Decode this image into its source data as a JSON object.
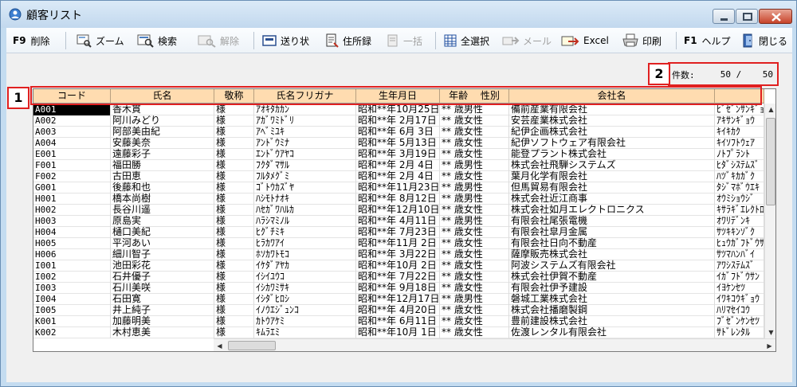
{
  "window": {
    "title": "顧客リスト"
  },
  "toolbar": {
    "delete": {
      "key": "F9",
      "label": "削除"
    },
    "zoom": "ズーム",
    "search": "検索",
    "release": "解除",
    "invoice": "送り状",
    "address_book": "住所録",
    "bulk": "一括",
    "select_all": "全選択",
    "mail": "メール",
    "excel": "Excel",
    "print": "印刷",
    "help": {
      "key": "F1",
      "label": "ヘルプ"
    },
    "close": "閉じる"
  },
  "count": {
    "label": "件数:",
    "value": "50 /    50"
  },
  "markers": {
    "m1": "1",
    "m2": "2"
  },
  "grid": {
    "columns": [
      "コード",
      "氏名",
      "敬称",
      "氏名フリガナ",
      "生年月日",
      "年齢　 性別",
      "会社名",
      ""
    ],
    "rows": [
      [
        "A001",
        "香木貫",
        "様",
        "ｱｵｷﾀｶｶﾝ",
        "昭和**年10月25日",
        "** 歳男性",
        "備前産業有限会社",
        "ﾋﾞｾﾞﾝｻﾝｷﾞｮ"
      ],
      [
        "A002",
        "阿川みどり",
        "様",
        "ｱｶﾞﾜﾐﾄﾞﾘ",
        "昭和**年 2月17日",
        "** 歳女性",
        "安芸産業株式会社",
        "ｱｷｻﾝｷﾞｮｳ"
      ],
      [
        "A003",
        "阿部美由紀",
        "様",
        "ｱﾍﾞﾐﾕｷ",
        "昭和**年 6月 3日",
        "** 歳女性",
        "紀伊企画株式会社",
        "ｷｲｷｶｸ"
      ],
      [
        "A004",
        "安藤美奈",
        "様",
        "ｱﾝﾄﾞｳﾐﾅ",
        "昭和**年 5月13日",
        "** 歳女性",
        "紀伊ソフトウェア有限会社",
        "ｷｲｿﾌﾄｳｪｱ"
      ],
      [
        "E001",
        "遠藤彩子",
        "様",
        "ｴﾝﾄﾞｳｱﾔｺ",
        "昭和**年 3月19日",
        "** 歳女性",
        "能登プラント株式会社",
        "ﾉﾄﾌﾟﾗﾝﾄ"
      ],
      [
        "F001",
        "福田勝",
        "様",
        "ﾌｸﾀﾞﾏｻﾙ",
        "昭和**年 2月 4日",
        "** 歳男性",
        "株式会社飛騨システムズ",
        "ﾋﾀﾞｼｽﾃﾑｽﾞ"
      ],
      [
        "F002",
        "古田恵",
        "様",
        "ﾌﾙﾀﾒｸﾞﾐ",
        "昭和**年 2月 4日",
        "** 歳女性",
        "葉月化学有限会社",
        "ﾊﾂﾞｷｶｶﾞｸ"
      ],
      [
        "G001",
        "後藤和也",
        "様",
        "ｺﾞﾄｳｶｽﾞﾔ",
        "昭和**年11月23日",
        "** 歳男性",
        "但馬貿易有限会社",
        "ﾀｼﾞﾏﾎﾞｳｴｷ"
      ],
      [
        "H001",
        "橋本尚樹",
        "様",
        "ﾊｼﾓﾄﾅｵｷ",
        "昭和**年 8月12日",
        "** 歳男性",
        "株式会社近江商事",
        "ｵｳﾐｼｮｳｼﾞ"
      ],
      [
        "H002",
        "長谷川遥",
        "様",
        "ﾊｾｶﾞﾜﾊﾙｶ",
        "昭和**年12月10日",
        "** 歳女性",
        "株式会社如月エレクトロニクス",
        "ｷｻﾗｷﾞｴﾚｸﾄﾛ"
      ],
      [
        "H003",
        "原島実",
        "様",
        "ﾊﾗｼﾏﾐﾉﾙ",
        "昭和**年 4月11日",
        "** 歳男性",
        "有限会社尾張電機",
        "ｵﾜﾘﾃﾞﾝｷ"
      ],
      [
        "H004",
        "樋口美紀",
        "様",
        "ﾋｸﾞﾁﾐｷ",
        "昭和**年 7月23日",
        "** 歳女性",
        "有限会社皐月金属",
        "ｻﾂｷｷﾝｿﾞｸ"
      ],
      [
        "H005",
        "平河あい",
        "様",
        "ﾋﾗｶﾜｱｲ",
        "昭和**年11月 2日",
        "** 歳女性",
        "有限会社日向不動産",
        "ﾋｭｳｶﾞﾌﾄﾞｳｻ"
      ],
      [
        "H006",
        "細川智子",
        "様",
        "ﾎｿｶﾜﾄﾓｺ",
        "昭和**年 3月22日",
        "** 歳女性",
        "薩摩販売株式会社",
        "ｻﾂﾏﾊﾝﾊﾞｲ"
      ],
      [
        "I001",
        "池田彩花",
        "様",
        "ｲｹﾀﾞｱﾔｶ",
        "昭和**年10月 2日",
        "** 歳女性",
        "阿波システムズ有限会社",
        "ｱﾜｼｽﾃﾑｽﾞ"
      ],
      [
        "I002",
        "石井優子",
        "様",
        "ｲｼｲﾕｳｺ",
        "昭和**年 7月22日",
        "** 歳女性",
        "株式会社伊賀不動産",
        "ｲｶﾞﾌﾄﾞｳｻﾝ"
      ],
      [
        "I003",
        "石川美咲",
        "様",
        "ｲｼｶﾜﾐｻｷ",
        "昭和**年 9月18日",
        "** 歳女性",
        "有限会社伊予建設",
        "ｲﾖｹﾝｾﾂ"
      ],
      [
        "I004",
        "石田寛",
        "様",
        "ｲｼﾀﾞﾋﾛｼ",
        "昭和**年12月17日",
        "** 歳男性",
        "磐城工業株式会社",
        "ｲﾜｷｺｳｷﾞｮｳ"
      ],
      [
        "I005",
        "井上純子",
        "様",
        "ｲﾉｳｴｼﾞｭﾝｺ",
        "昭和**年 4月20日",
        "** 歳女性",
        "株式会社播磨製鋼",
        "ﾊﾘﾏｾｲｺｳ"
      ],
      [
        "K001",
        "加藤明美",
        "様",
        "ｶﾄｳｱｹﾐ",
        "昭和**年 6月11日",
        "** 歳女性",
        "豊前建設株式会社",
        "ﾌﾞｾﾞﾝｹﾝｾﾂ"
      ],
      [
        "K002",
        "木村恵美",
        "様",
        "ｷﾑﾗｴﾐ",
        "昭和**年10月 1日",
        "** 歳女性",
        "佐渡レンタル有限会社",
        "ｻﾄﾞﾚﾝﾀﾙ"
      ]
    ]
  }
}
